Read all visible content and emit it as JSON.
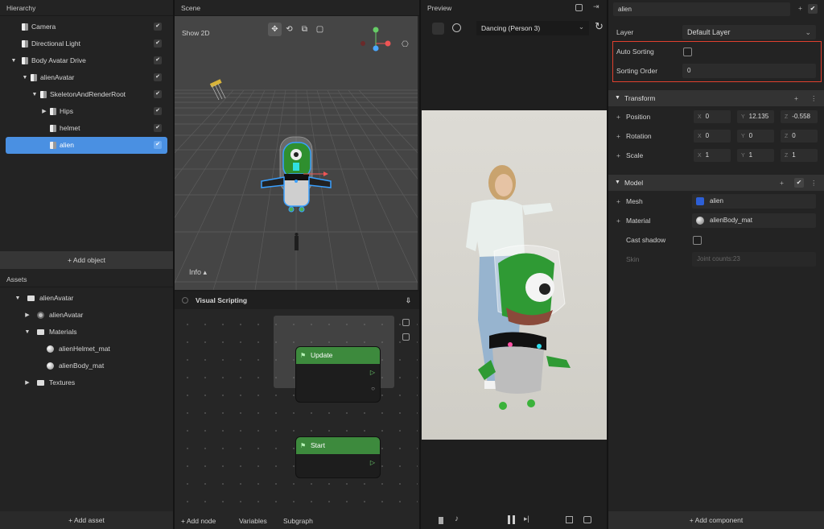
{
  "hierarchy": {
    "title": "Hierarchy",
    "items": [
      {
        "label": "Camera",
        "depth": 0,
        "arrow": "",
        "checked": true
      },
      {
        "label": "Directional Light",
        "depth": 0,
        "arrow": "",
        "checked": true
      },
      {
        "label": "Body Avatar Drive",
        "depth": 0,
        "arrow": "▼",
        "checked": true
      },
      {
        "label": "alienAvatar",
        "depth": 1,
        "arrow": "▼",
        "checked": true
      },
      {
        "label": "SkeletonAndRenderRoot",
        "depth": 2,
        "arrow": "▼",
        "checked": true
      },
      {
        "label": "Hips",
        "depth": 3,
        "arrow": "▶",
        "checked": true
      },
      {
        "label": "helmet",
        "depth": 3,
        "arrow": "",
        "checked": true
      },
      {
        "label": "alien",
        "depth": 3,
        "arrow": "",
        "checked": true,
        "selected": true
      }
    ],
    "add_button": "+ Add object",
    "check_glyph": "✔"
  },
  "assets": {
    "title": "Assets",
    "items": [
      {
        "label": "alienAvatar",
        "depth": 0,
        "arrow": "▼",
        "icon": "folder"
      },
      {
        "label": "alienAvatar",
        "depth": 1,
        "arrow": "▶",
        "icon": "model"
      },
      {
        "label": "Materials",
        "depth": 1,
        "arrow": "▼",
        "icon": "folder"
      },
      {
        "label": "alienHelmet_mat",
        "depth": 2,
        "arrow": "",
        "icon": "material"
      },
      {
        "label": "alienBody_mat",
        "depth": 2,
        "arrow": "",
        "icon": "material"
      },
      {
        "label": "Textures",
        "depth": 1,
        "arrow": "▶",
        "icon": "folder"
      }
    ],
    "add_button": "+ Add asset"
  },
  "scene": {
    "title": "Scene",
    "show2d": "Show 2D",
    "info": "Info ▴",
    "tools": [
      "move-tool",
      "rotate-tool",
      "scale-tool",
      "rect-tool"
    ],
    "tool_glyphs": [
      "✥",
      "⟲",
      "⧉",
      "▢"
    ],
    "gizmo": {
      "y": "Y",
      "x": "X",
      "z": "Z"
    },
    "camera_glyph": "⎔"
  },
  "visual_scripting": {
    "title": "Visual Scripting",
    "nodes": [
      {
        "label": "Update",
        "ports": [
          "▷",
          "○"
        ]
      },
      {
        "label": "Start",
        "ports": [
          "▷"
        ]
      }
    ],
    "flag_glyph": "⚑",
    "bottom": {
      "add_node": "+ Add node",
      "variables": "Variables",
      "subgraph": "Subgraph"
    }
  },
  "preview": {
    "title": "Preview",
    "animation": "Dancing (Person 3)",
    "dropdown_glyph": "⌄",
    "refresh_glyph": "↻"
  },
  "inspector": {
    "object_name": "alien",
    "layer_label": "Layer",
    "layer_value": "Default Layer",
    "auto_sorting_label": "Auto Sorting",
    "auto_sorting_checked": false,
    "sorting_order_label": "Sorting Order",
    "sorting_order_value": "0",
    "transform": {
      "title": "Transform",
      "rows": [
        {
          "label": "Position",
          "x": "0",
          "y": "12.135",
          "z": "-0.558"
        },
        {
          "label": "Rotation",
          "x": "0",
          "y": "0",
          "z": "0"
        },
        {
          "label": "Scale",
          "x": "1",
          "y": "1",
          "z": "1"
        }
      ]
    },
    "model": {
      "title": "Model",
      "mesh_label": "Mesh",
      "mesh_value": "alien",
      "material_label": "Material",
      "material_value": "alienBody_mat",
      "cast_shadow_label": "Cast shadow",
      "cast_shadow_checked": false,
      "skin_label": "Skin",
      "skin_value": "Joint counts:23"
    },
    "add_component": "+ Add component",
    "highlight_color": "#e0402e"
  },
  "colors": {
    "selection": "#4a90e2",
    "node_header": "#3d8a3d",
    "port": "#6fd36f"
  }
}
